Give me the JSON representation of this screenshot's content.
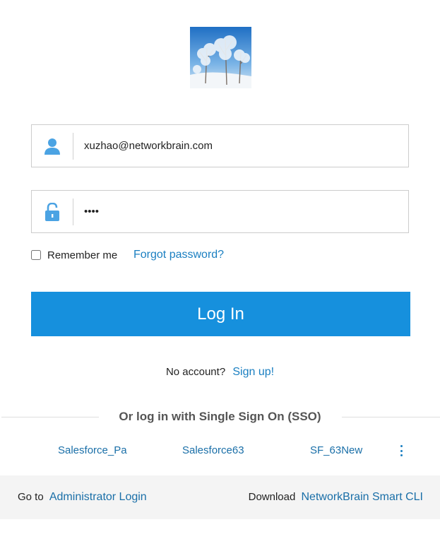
{
  "login": {
    "username_value": "xuzhao@networkbrain.com",
    "password_value": "1234",
    "remember_label": "Remember me",
    "forgot_label": "Forgot password?",
    "login_label": "Log In"
  },
  "signup": {
    "prompt": "No account?",
    "link": "Sign up!"
  },
  "sso": {
    "title": "Or log in with Single Sign On (SSO)",
    "providers": [
      "Salesforce_Pa",
      "Salesforce63",
      "SF_63New"
    ]
  },
  "footer": {
    "goto_prefix": "Go to",
    "admin_link": "Administrator Login",
    "download_prefix": "Download",
    "cli_link": "NetworkBrain Smart CLI"
  },
  "colors": {
    "accent": "#1690dd",
    "link": "#1a7fc1",
    "icon": "#4ba3e3",
    "footer_bg": "#f4f4f4"
  },
  "icons": {
    "username": "user-icon",
    "password": "lock-icon",
    "more": "more-vertical-icon"
  }
}
